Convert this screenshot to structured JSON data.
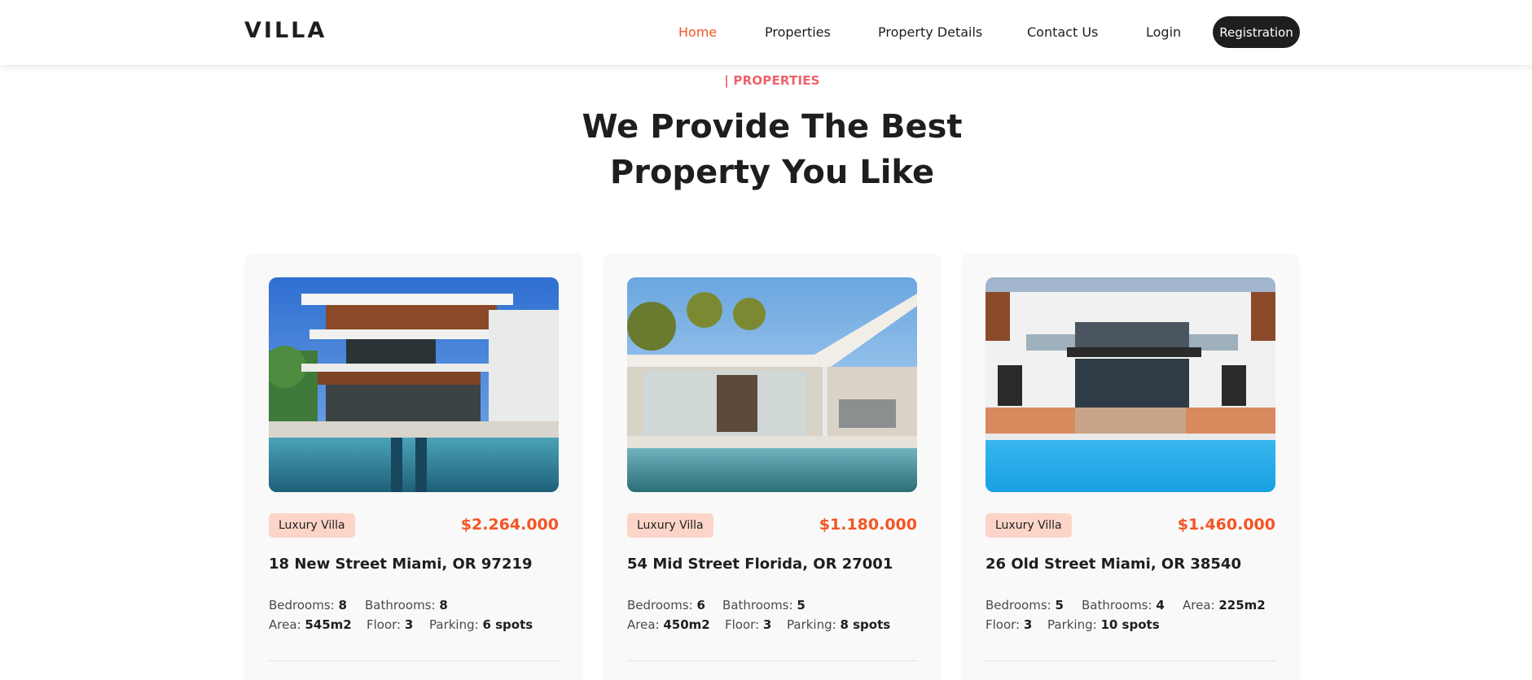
{
  "header": {
    "logo": "VILLA",
    "nav": [
      {
        "label": "Home",
        "active": true
      },
      {
        "label": "Properties",
        "active": false
      },
      {
        "label": "Property Details",
        "active": false
      },
      {
        "label": "Contact Us",
        "active": false
      },
      {
        "label": "Login",
        "active": false
      }
    ],
    "register_label": "Registration"
  },
  "section": {
    "eyebrow": "| PROPERTIES",
    "title_line1": "We Provide The Best",
    "title_line2": "Property You Like"
  },
  "colors": {
    "accent": "#f35525",
    "eyebrow": "#ee626b",
    "dark": "#1e1e1e",
    "tag_bg": "#fcd5c8",
    "card_bg": "#f9f9f9"
  },
  "properties": [
    {
      "tag": "Luxury Villa",
      "price": "$2.264.000",
      "address": "18 New Street Miami, OR 97219",
      "specs": [
        {
          "label": "Bedrooms:",
          "value": "8"
        },
        {
          "label": "Bathrooms:",
          "value": "8"
        },
        {
          "label": "Area:",
          "value": "545m2"
        },
        {
          "label": "Floor:",
          "value": "3"
        },
        {
          "label": "Parking:",
          "value": "6 spots"
        }
      ]
    },
    {
      "tag": "Luxury Villa",
      "price": "$1.180.000",
      "address": "54 Mid Street Florida, OR 27001",
      "specs": [
        {
          "label": "Bedrooms:",
          "value": "6"
        },
        {
          "label": "Bathrooms:",
          "value": "5"
        },
        {
          "label": "Area:",
          "value": "450m2"
        },
        {
          "label": "Floor:",
          "value": "3"
        },
        {
          "label": "Parking:",
          "value": "8 spots"
        }
      ]
    },
    {
      "tag": "Luxury Villa",
      "price": "$1.460.000",
      "address": "26 Old Street Miami, OR 38540",
      "specs": [
        {
          "label": "Bedrooms:",
          "value": "5"
        },
        {
          "label": "Bathrooms:",
          "value": "4"
        },
        {
          "label": "Area:",
          "value": "225m2"
        },
        {
          "label": "Floor:",
          "value": "3"
        },
        {
          "label": "Parking:",
          "value": "10 spots"
        }
      ]
    }
  ]
}
